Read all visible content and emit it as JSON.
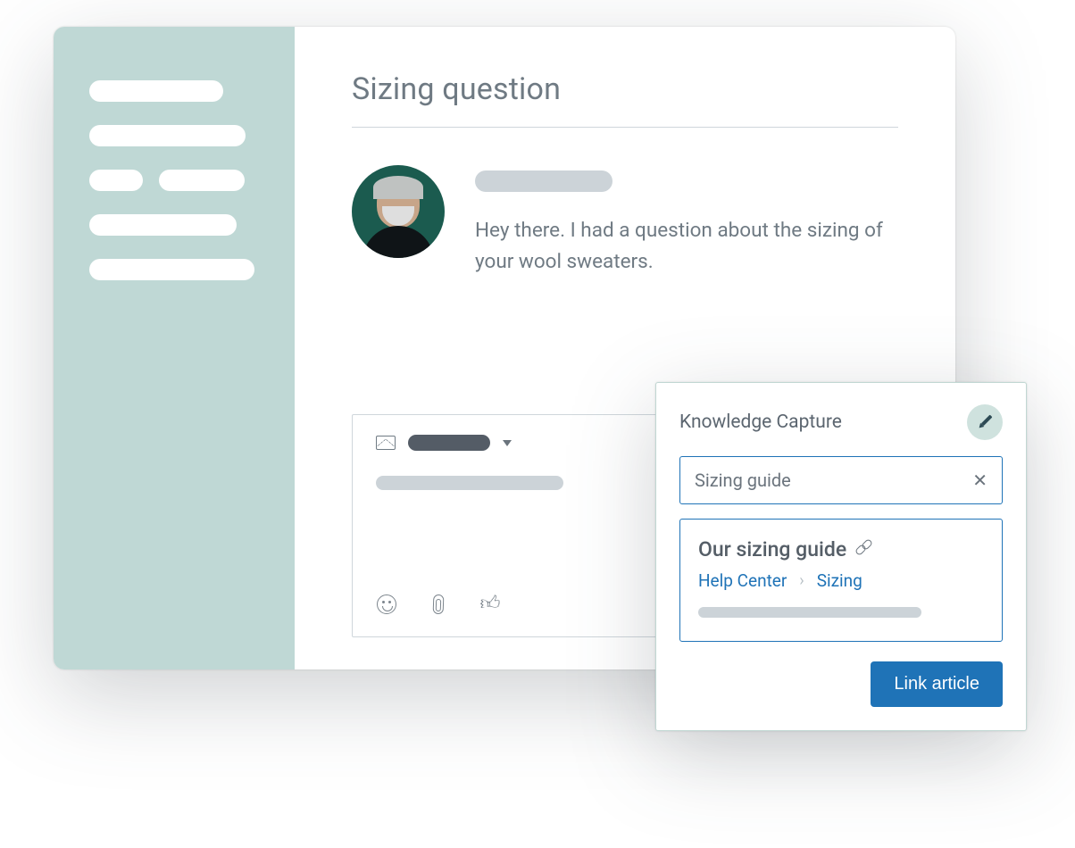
{
  "ticket": {
    "title": "Sizing question",
    "message": "Hey there. I had a question about the sizing of your wool sweaters."
  },
  "knowledge_capture": {
    "panel_title": "Knowledge Capture",
    "search_value": "Sizing guide",
    "result": {
      "title": "Our sizing guide",
      "breadcrumb": {
        "root": "Help Center",
        "leaf": "Sizing"
      }
    },
    "link_button": "Link article"
  }
}
